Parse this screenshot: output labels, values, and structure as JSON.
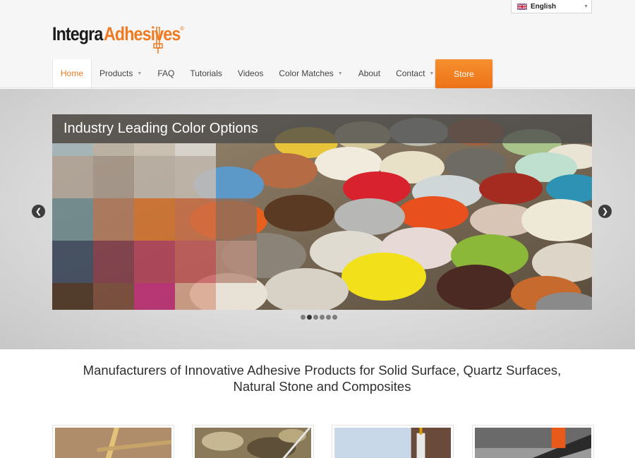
{
  "brand": {
    "name_part1": "Integra",
    "name_part2": "Adhesives",
    "registered": "®",
    "accent_color": "#ee7b23"
  },
  "language": {
    "selected": "English",
    "flag_icon": "uk-flag-icon"
  },
  "nav": {
    "items": [
      {
        "label": "Home",
        "active": true,
        "dropdown": false
      },
      {
        "label": "Products",
        "active": false,
        "dropdown": true
      },
      {
        "label": "FAQ",
        "active": false,
        "dropdown": false
      },
      {
        "label": "Tutorials",
        "active": false,
        "dropdown": false
      },
      {
        "label": "Videos",
        "active": false,
        "dropdown": false
      },
      {
        "label": "Color Matches",
        "active": false,
        "dropdown": true
      },
      {
        "label": "About",
        "active": false,
        "dropdown": false
      },
      {
        "label": "Contact",
        "active": false,
        "dropdown": true
      }
    ],
    "store_label": "Store"
  },
  "slider": {
    "caption": "Industry Leading Color Options",
    "prev_icon": "chevron-left-icon",
    "next_icon": "chevron-right-icon",
    "slide_count": 6,
    "active_index": 1
  },
  "tagline": {
    "line1": "Manufacturers of Innovative Adhesive Products for Solid Surface, Quartz Surfaces,",
    "line2": "Natural Stone and Composites"
  }
}
